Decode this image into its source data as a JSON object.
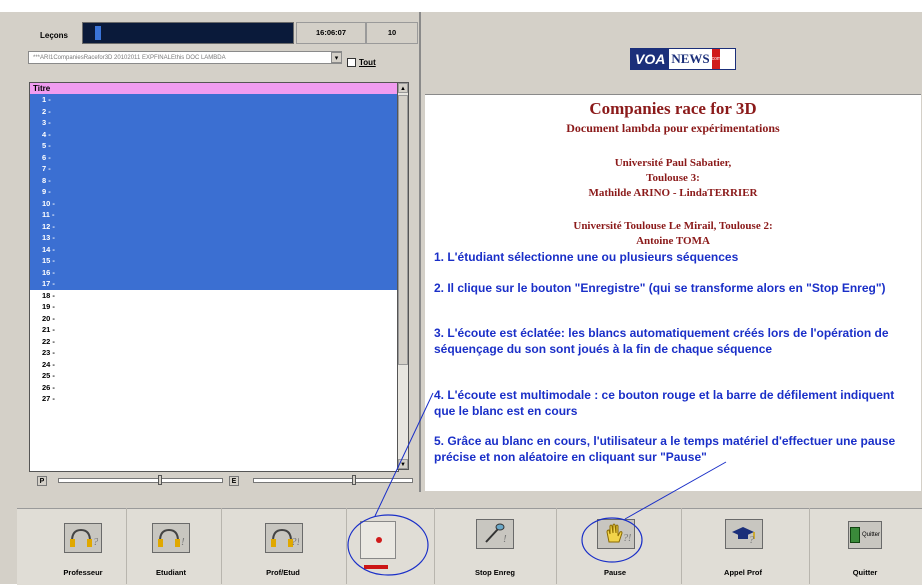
{
  "header": {
    "lessons_label": "Leçons",
    "time": "16:06:07",
    "count": "10",
    "combo_value": "***ARI1CompaniesRacefor3D 20102011 EXPFINALEthis DOC LAMBDA",
    "tout_label": "Tout"
  },
  "list": {
    "header": "Titre",
    "rows": [
      "1 -",
      "2 -",
      "3 -",
      "4 -",
      "5 -",
      "6 -",
      "7 -",
      "8 -",
      "9 -",
      "10 -",
      "11 -",
      "12 -",
      "13 -",
      "14 -",
      "15 -",
      "16 -",
      "17 -",
      "18 -",
      "19 -",
      "20 -",
      "21 -",
      "22 -",
      "23 -",
      "24 -",
      "25 -",
      "26 -",
      "27 -"
    ],
    "selected_count": 17
  },
  "sliders": {
    "p_label": "P",
    "e_label": "E"
  },
  "logo": {
    "voa": "VOA",
    "news": "NEWS",
    "com": "com"
  },
  "document": {
    "title": "Companies race for 3D",
    "subtitle": "Document lambda pour expérimentations",
    "credit1_line1": "Université Paul Sabatier,",
    "credit1_line2": "Toulouse 3:",
    "credit1_line3": "Mathilde ARINO - LindaTERRIER",
    "credit2_line1": "Université Toulouse Le Mirail, Toulouse 2:",
    "credit2_line2": "Antoine TOMA",
    "steps": [
      "1. L'étudiant sélectionne une ou plusieurs séquences",
      "2. Il clique sur le bouton \"Enregistre\" (qui se transforme alors en \"Stop Enreg\")",
      "3. L'écoute est éclatée: les blancs automatiquement créés lors de l'opération de séquençage du son sont joués à la fin de chaque séquence",
      "4. L'écoute est multimodale : ce bouton rouge et la barre de défilement indiquent que le blanc est en cours",
      "5. Grâce au blanc en cours, l'utilisateur a le temps matériel d'effectuer une pause précise et non aléatoire en cliquant sur \"Pause\""
    ]
  },
  "toolbar": {
    "buttons": [
      {
        "label": "Professeur",
        "icon": "headphones-question-icon"
      },
      {
        "label": "Etudiant",
        "icon": "headphones-exclamation-icon"
      },
      {
        "label": "Prof/Etud",
        "icon": "headphones-split-icon"
      },
      {
        "label": "",
        "icon": "record-dot-icon"
      },
      {
        "label": "Stop Enreg",
        "icon": "microphone-icon"
      },
      {
        "label": "Pause",
        "icon": "hand-icon"
      },
      {
        "label": "Appel Prof",
        "icon": "graduation-cap-icon"
      },
      {
        "label": "Quitter",
        "icon": "door-exit-icon",
        "button_text": "Quitter"
      }
    ]
  },
  "colors": {
    "selection": "#3b6fd2",
    "header_pink": "#f09cf0",
    "doc_title": "#8b1a1a",
    "doc_steps": "#1a2fc8",
    "annotation": "#1a2fc8",
    "record": "#d01b1b"
  }
}
